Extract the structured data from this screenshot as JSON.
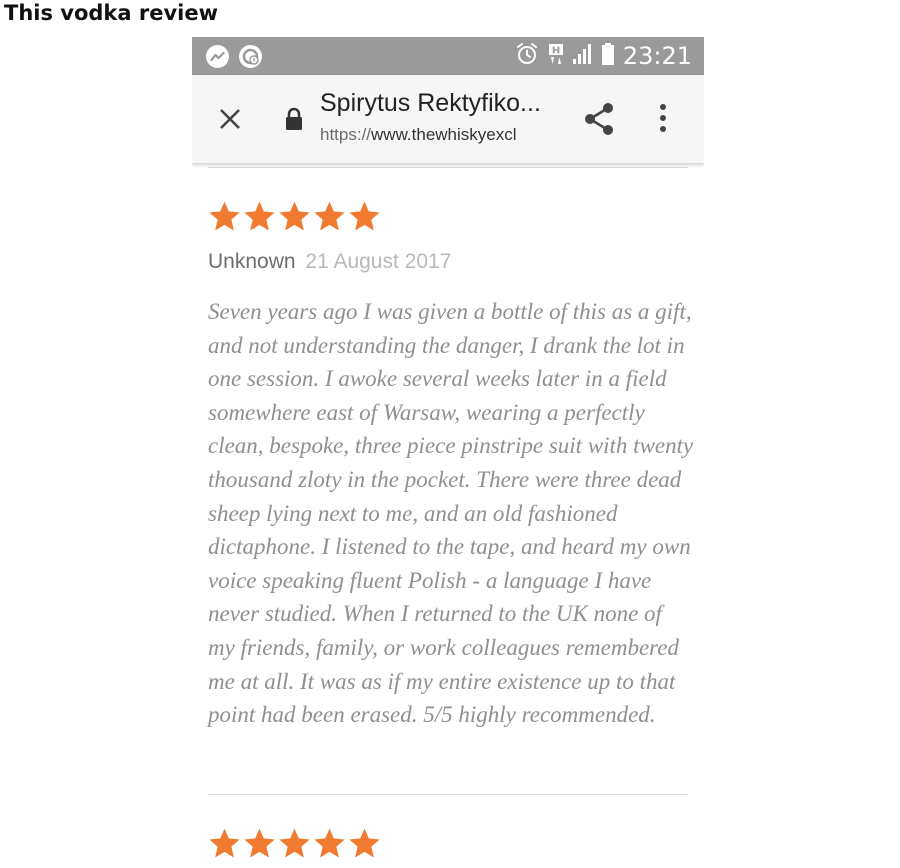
{
  "post": {
    "title": "This vodka review"
  },
  "status_bar": {
    "left_icons": [
      "messenger-icon",
      "chrome-notification-icon"
    ],
    "right_icons": [
      "alarm-icon",
      "network-h-icon",
      "signal-icon",
      "battery-icon"
    ],
    "time": "23:21"
  },
  "toolbar": {
    "close_icon": "close-icon",
    "lock_icon": "lock-icon",
    "page_title": "Spirytus Rektyfiko...",
    "url_scheme": "https://",
    "url_host": "www.thewhiskyexcl",
    "share_icon": "share-icon",
    "menu_icon": "more-vert-icon"
  },
  "reviews": [
    {
      "rating": 5,
      "max_rating": 5,
      "author": "Unknown",
      "date": "21 August 2017",
      "text": "Seven years ago I was given a bottle of this as a gift, and not understanding the danger, I drank the lot in one session. I awoke several weeks later in a field somewhere east of Warsaw, wearing a perfectly clean, bespoke, three piece pinstripe suit with twenty thousand zloty in the pocket. There were three dead sheep lying next to me, and an old fashioned dictaphone. I listened to the tape, and heard my own voice speaking fluent Polish - a language I have never studied. When I returned to the UK none of my friends, family, or work colleagues remembered me at all. It was as if my entire existence up to that point had been erased. 5/5 highly recommended."
    },
    {
      "rating": 5,
      "max_rating": 5
    }
  ],
  "colors": {
    "star": "#f07a2f",
    "status_bar": "#9a9a9a",
    "toolbar": "#f6f6f6",
    "review_text": "#8f8f8f",
    "date_text": "#b8b8b8",
    "author_text": "#6e6e6e"
  }
}
